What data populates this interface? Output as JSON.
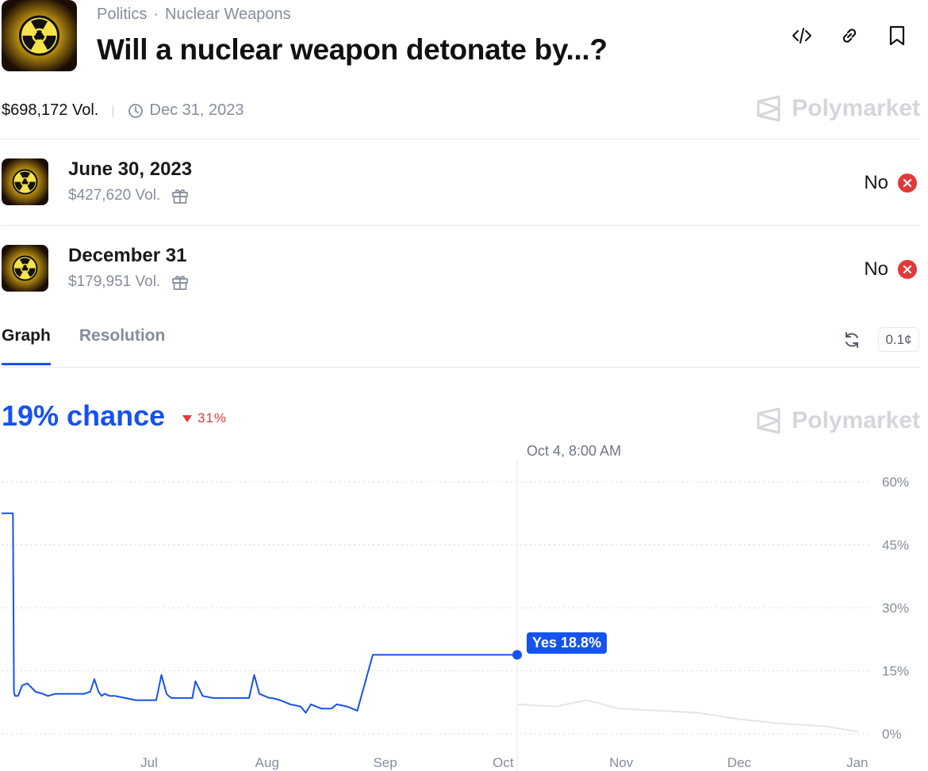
{
  "header": {
    "breadcrumb": [
      "Politics",
      "Nuclear Weapons"
    ],
    "title": "Will a nuclear weapon detonate by...?",
    "volume": "$698,172 Vol.",
    "end_date": "Dec 31, 2023",
    "brand": "Polymarket",
    "icons": [
      "embed-code-icon",
      "link-icon",
      "bookmark-icon"
    ]
  },
  "markets": [
    {
      "title": "June 30, 2023",
      "volume": "$427,620 Vol.",
      "outcome": "No"
    },
    {
      "title": "December 31",
      "volume": "$179,951 Vol.",
      "outcome": "No"
    }
  ],
  "tabs": {
    "graph": "Graph",
    "resolution": "Resolution",
    "precision": "0.1¢"
  },
  "graph": {
    "chance": "19% chance",
    "delta": "31%",
    "hover_time": "Oct 4, 8:00 AM",
    "tooltip": "Yes 18.8%",
    "brand": "Polymarket"
  },
  "colors": {
    "accent": "#1652f0",
    "negative": "#e23838",
    "muted": "#858d9b"
  },
  "chart_data": {
    "type": "line",
    "ylim": [
      0,
      60
    ],
    "y_ticks": [
      0,
      15,
      30,
      45,
      60
    ],
    "y_tick_labels": [
      "0%",
      "15%",
      "30%",
      "45%",
      "60%"
    ],
    "x_ticks": [
      "Jul",
      "Aug",
      "Sep",
      "Oct",
      "Nov",
      "Dec",
      "Jan"
    ],
    "grid": true,
    "series": [
      {
        "x": [
          0.0,
          0.05,
          0.06,
          0.09,
          0.11,
          0.12,
          0.13,
          0.16,
          0.2,
          0.25,
          0.33,
          0.4,
          0.45,
          0.52,
          0.6,
          0.68,
          0.75,
          0.8,
          0.86,
          0.9,
          0.94,
          0.97,
          1.0,
          1.05,
          1.1,
          1.2,
          1.3,
          1.4,
          1.5,
          1.55,
          1.6,
          1.62,
          1.65,
          1.7,
          1.8,
          1.85,
          1.88,
          1.95,
          2.05,
          2.15,
          2.3,
          2.4,
          2.45,
          2.5,
          2.55,
          2.6,
          2.62,
          2.7,
          2.8,
          2.9,
          2.95,
          3.0,
          3.05,
          3.1,
          3.2,
          3.25,
          3.35,
          3.45,
          3.6,
          3.75,
          3.9,
          4.0,
          4.1,
          4.2,
          4.3,
          4.4,
          4.5,
          4.6,
          4.65,
          4.7,
          4.8,
          4.9,
          5.0
        ],
        "y": [
          52.5,
          52.5,
          52.5,
          52.5,
          52.5,
          10,
          9,
          9,
          11.5,
          12,
          10,
          9.5,
          9,
          9.5,
          9.5,
          9.5,
          9.5,
          9.5,
          10,
          13,
          10,
          9,
          9.5,
          9,
          9,
          8.5,
          8,
          8,
          8,
          14,
          9.5,
          9,
          8.5,
          8.5,
          8.5,
          8.5,
          12.5,
          9,
          8.5,
          8.5,
          8.5,
          8.5,
          14,
          9.5,
          9,
          8.5,
          8.5,
          8,
          7,
          6.5,
          5,
          7,
          6.5,
          6,
          6,
          7,
          6.5,
          5.5,
          18.8,
          18.8,
          18.8,
          18.8,
          18.8,
          18.8,
          18.8,
          18.8,
          18.8,
          18.8,
          18.8,
          18.8,
          18.8,
          18.8,
          18.8
        ],
        "note": ""
      }
    ]
  }
}
